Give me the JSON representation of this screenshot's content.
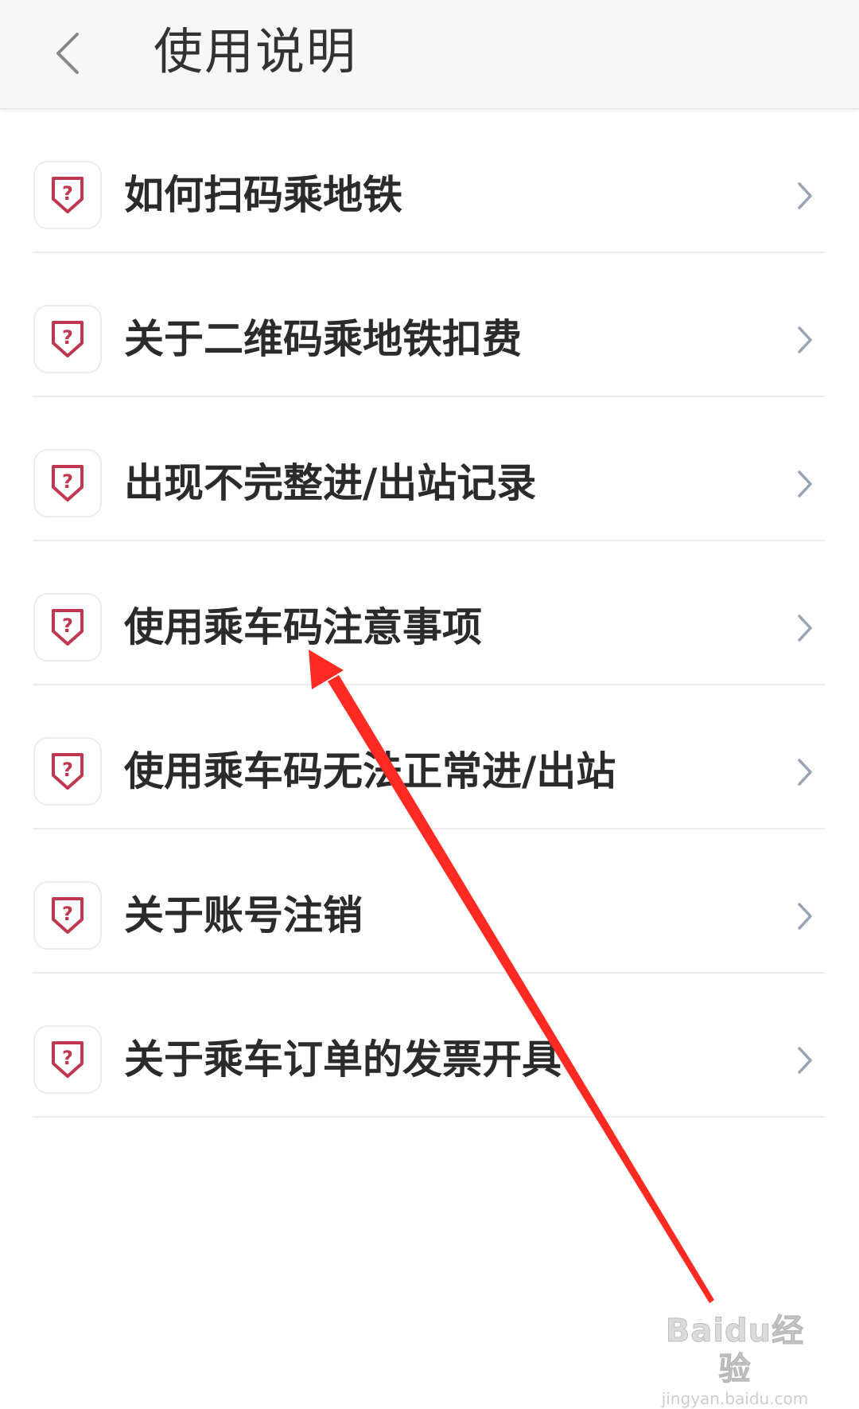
{
  "header": {
    "title": "使用说明",
    "back_icon": "chevron-left-icon"
  },
  "list": {
    "items": [
      {
        "label": "如何扫码乘地铁",
        "icon": "question-shield-icon"
      },
      {
        "label": "关于二维码乘地铁扣费",
        "icon": "question-shield-icon"
      },
      {
        "label": "出现不完整进/出站记录",
        "icon": "question-shield-icon"
      },
      {
        "label": "使用乘车码注意事项",
        "icon": "question-shield-icon"
      },
      {
        "label": "使用乘车码无法正常进/出站",
        "icon": "question-shield-icon"
      },
      {
        "label": "关于账号注销",
        "icon": "question-shield-icon"
      },
      {
        "label": "关于乘车订单的发票开具",
        "icon": "question-shield-icon"
      }
    ]
  },
  "watermark": {
    "brand": "Baidu经验",
    "url": "jingyan.baidu.com"
  },
  "colors": {
    "icon_accent": "#c0384f",
    "chevron": "#9aa4b5",
    "annotation_arrow": "#ff2a22"
  }
}
